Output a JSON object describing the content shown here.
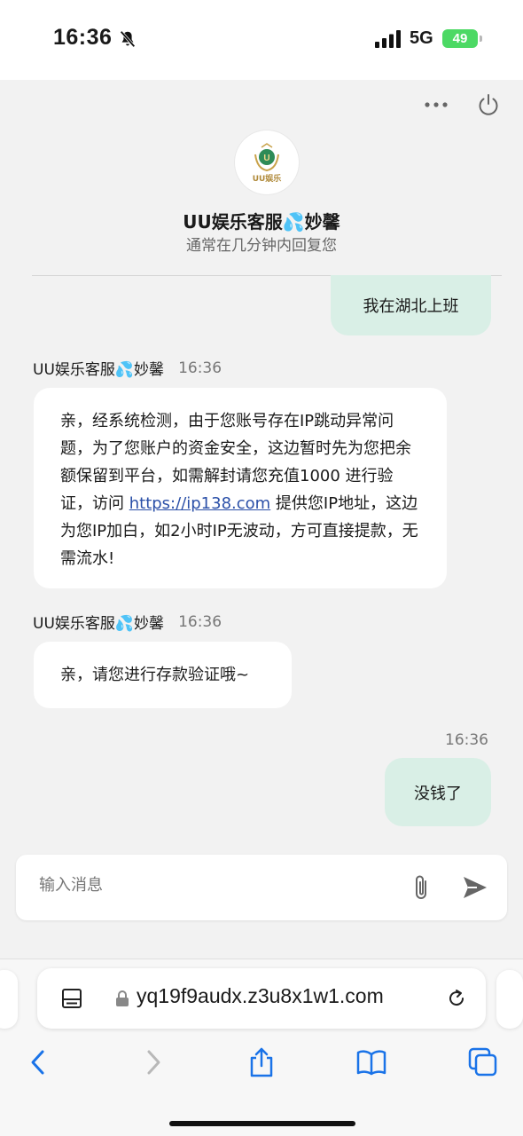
{
  "status_bar": {
    "time": "16:36",
    "network": "5G",
    "battery": "49"
  },
  "chat": {
    "agent_name": "UU娱乐客服💦妙馨",
    "agent_subtitle": "通常在几分钟内回复您",
    "avatar_text": "UU娱乐",
    "messages": [
      {
        "direction": "out",
        "text": "我在湖北上班"
      },
      {
        "direction": "in",
        "sender": "UU娱乐客服💦妙馨",
        "time": "16:36",
        "text_part1": "亲，经系统检测，由于您账号存在IP跳动异常问题，为了您账户的资金安全，这边暂时先为您把余额保留到平台，如需解封请您充值1000 进行验证，访问 ",
        "link": "https://ip138.com",
        "text_part2": " 提供您IP地址，这边为您IP加白，如2小时IP无波动，方可直接提款，无需流水!"
      },
      {
        "direction": "in",
        "sender": "UU娱乐客服💦妙馨",
        "time": "16:36",
        "text": "亲，请您进行存款验证哦~"
      },
      {
        "direction": "out",
        "time": "16:36",
        "text": "没钱了"
      }
    ]
  },
  "composer": {
    "placeholder": "输入消息"
  },
  "browser": {
    "url": "yq19f9audx.z3u8x1w1.com"
  },
  "colors": {
    "outgoing_bubble": "#d9efe6",
    "incoming_bubble": "#ffffff",
    "link": "#2b50a8",
    "toolbar_blue": "#1a73e8"
  }
}
